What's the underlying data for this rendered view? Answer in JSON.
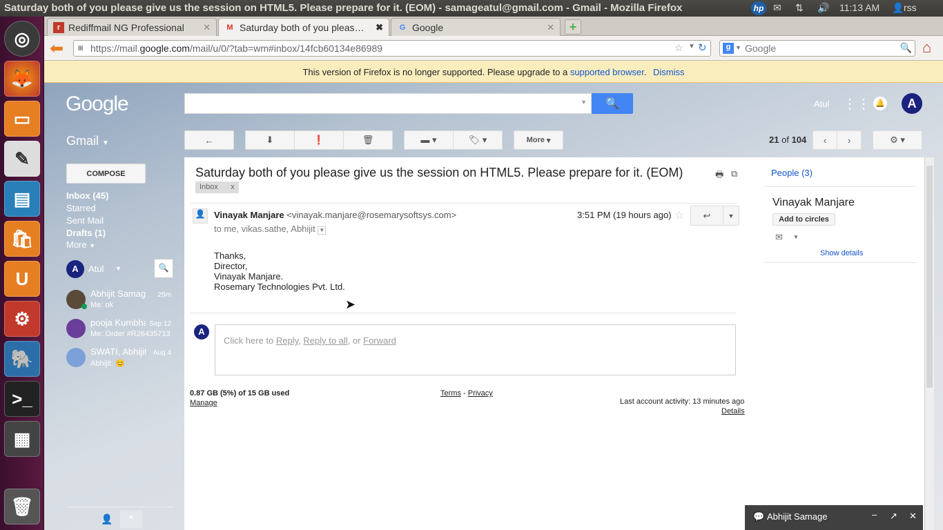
{
  "os": {
    "window_title": "Saturday both of you please give us the session on HTML5. Please prepare for it. (EOM) - samageatul@gmail.com - Gmail - Mozilla Firefox",
    "clock": "11:13 AM",
    "user": "rss"
  },
  "browser": {
    "tabs": [
      {
        "label": "Rediffmail NG Professional"
      },
      {
        "label": "Saturday both of you pleas…"
      },
      {
        "label": "Google"
      }
    ],
    "url_prefix": "https://mail.",
    "url_domain": "google.com",
    "url_suffix": "/mail/u/0/?tab=wm#inbox/14fcb60134e86989",
    "search_placeholder": "Google",
    "notice_text": "This version of Firefox is no longer supported. Please upgrade to a",
    "notice_link": "supported browser",
    "notice_dismiss": "Dismiss"
  },
  "gmail": {
    "logo": "Google",
    "account_name": "Atul",
    "avatar_letter": "A",
    "app_label": "Gmail",
    "more_btn": "More",
    "pager_current": "21",
    "pager_of": "of",
    "pager_total": "104",
    "compose": "COMPOSE",
    "nav": [
      {
        "label": "Inbox (45)"
      },
      {
        "label": "Starred"
      },
      {
        "label": "Sent Mail"
      },
      {
        "label": "Drafts (1)"
      },
      {
        "label": "More"
      }
    ],
    "chat_user": "Atul",
    "chats": [
      {
        "name": "Abhijit Samage",
        "time": "25m",
        "snippet": "Me: ok"
      },
      {
        "name": "pooja Kumbhar",
        "time": "Sep 12",
        "snippet": "Me:  Order #R26435713"
      },
      {
        "name": "SWATI, Abhijit",
        "time": "Aug 4",
        "snippet": "Abhijit: 😊"
      }
    ],
    "message": {
      "subject": "Saturday both of you please give us the session on HTML5. Please prepare for it. (EOM)",
      "label": "Inbox",
      "label_x": "x",
      "sender_name": "Vinayak Manjare",
      "sender_email": "<vinayak.manjare@rosemarysoftsys.com>",
      "recipients": "to me, vikas.sathe, Abhijit",
      "time": "3:51 PM (19 hours ago)",
      "body": [
        "Thanks,",
        "Director,",
        "Vinayak Manjare.",
        "Rosemary Technologies Pvt. Ltd."
      ],
      "reply_prefix": "Click here to",
      "reply": "Reply",
      "reply_all": "Reply to all",
      "or": ", or",
      "forward": "Forward"
    },
    "footer": {
      "storage": "0.87 GB (5%) of 15 GB used",
      "manage": "Manage",
      "terms": "Terms",
      "privacy": "Privacy",
      "activity": "Last account activity: 13 minutes ago",
      "details": "Details"
    },
    "people": {
      "header": "People (3)",
      "name": "Vinayak Manjare",
      "add_circles": "Add to circles",
      "show_details": "Show details"
    },
    "chat_popup": "Abhijit Samage"
  }
}
